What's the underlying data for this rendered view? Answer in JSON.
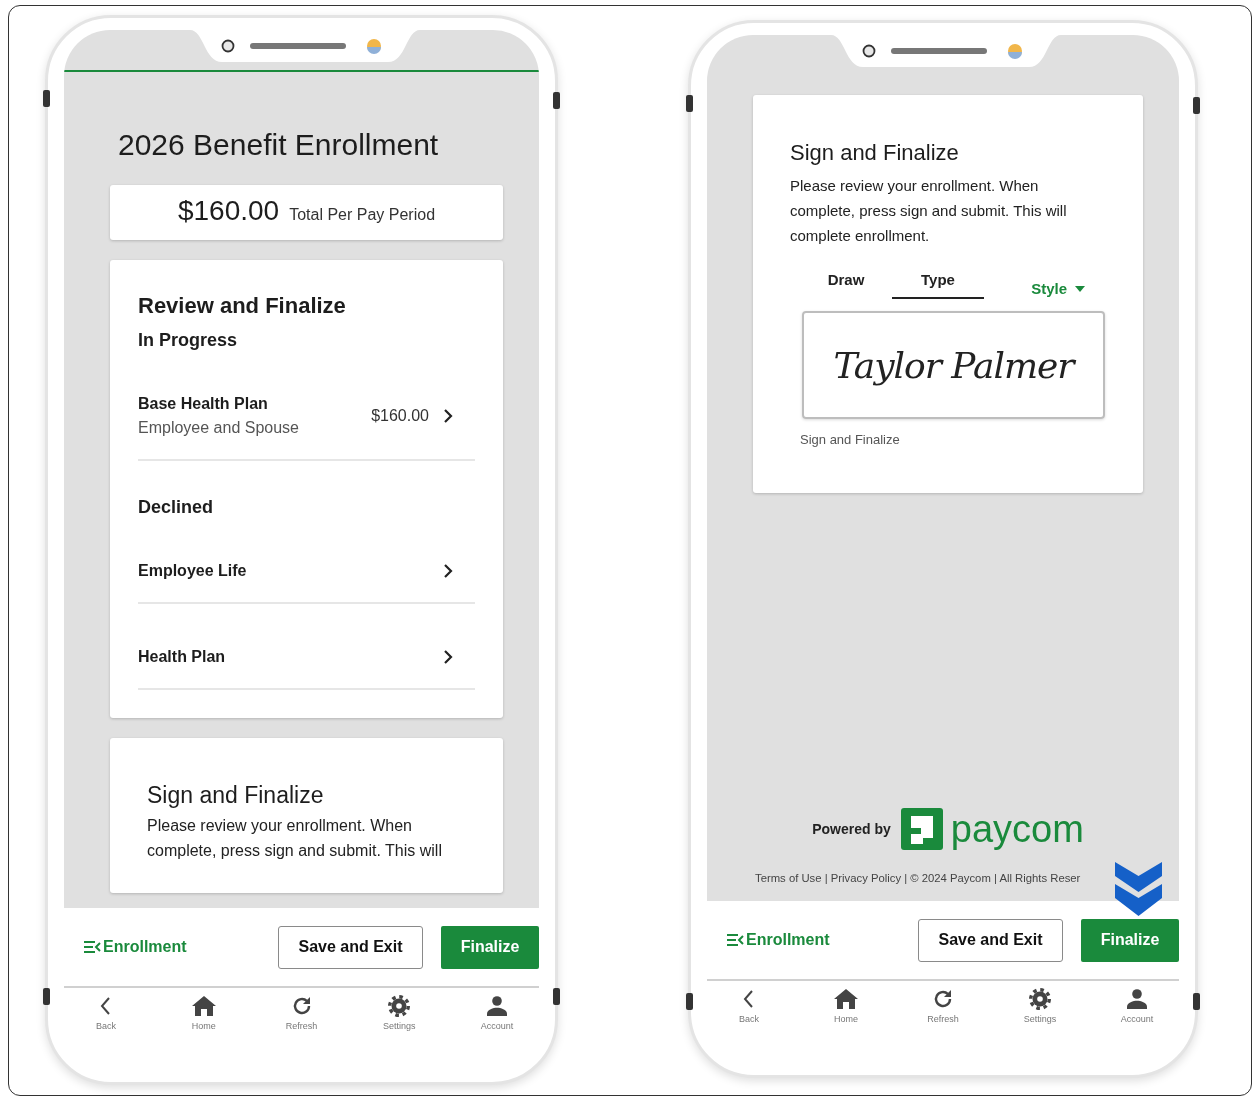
{
  "phones": [
    {
      "kind": "enrollment",
      "accent_line": true,
      "title": "2026 Benefit Enrollment",
      "total": {
        "amount": "$160.00",
        "label": "Total Per Pay Period"
      },
      "review": {
        "heading": "Review and Finalize",
        "groups": [
          {
            "heading": "In Progress",
            "items": [
              {
                "name": "Base Health Plan",
                "detail": "Employee and Spouse",
                "amount": "$160.00"
              }
            ]
          },
          {
            "heading": "Declined",
            "items": [
              {
                "name": "Employee Life"
              },
              {
                "name": "Health Plan"
              }
            ]
          }
        ]
      },
      "sign": {
        "heading": "Sign and Finalize",
        "text": "Please review your enrollment. When complete, press sign and submit. This will"
      },
      "actions": {
        "menu": "Enrollment",
        "secondary": "Save and Exit",
        "primary": "Finalize"
      },
      "nav": [
        {
          "kind": "back",
          "label": "Back"
        },
        {
          "kind": "home",
          "label": "Home"
        },
        {
          "kind": "refresh",
          "label": "Refresh"
        },
        {
          "kind": "settings",
          "label": "Settings"
        },
        {
          "kind": "account",
          "label": "Account"
        }
      ]
    },
    {
      "kind": "signature",
      "accent_line": false,
      "sign": {
        "heading": "Sign and Finalize",
        "text": "Please review your enrollment. When complete, press sign and submit. This will complete enrollment.",
        "tabs": [
          {
            "label": "Draw",
            "selected": false
          },
          {
            "label": "Type",
            "selected": true
          }
        ],
        "style": "Style",
        "signature": "Taylor Palmer",
        "caption": "Sign and Finalize"
      },
      "footer": {
        "powered_by": "Powered by",
        "logo": "paycom",
        "legal": "Terms of Use | Privacy Policy | © 2024 Paycom | All Rights Reser"
      },
      "actions": {
        "menu": "Enrollment",
        "secondary": "Save and Exit",
        "primary": "Finalize"
      },
      "nav": [
        {
          "kind": "back",
          "label": "Back"
        },
        {
          "kind": "home",
          "label": "Home"
        },
        {
          "kind": "refresh",
          "label": "Refresh"
        },
        {
          "kind": "settings",
          "label": "Settings"
        },
        {
          "kind": "account",
          "label": "Account"
        }
      ]
    }
  ]
}
